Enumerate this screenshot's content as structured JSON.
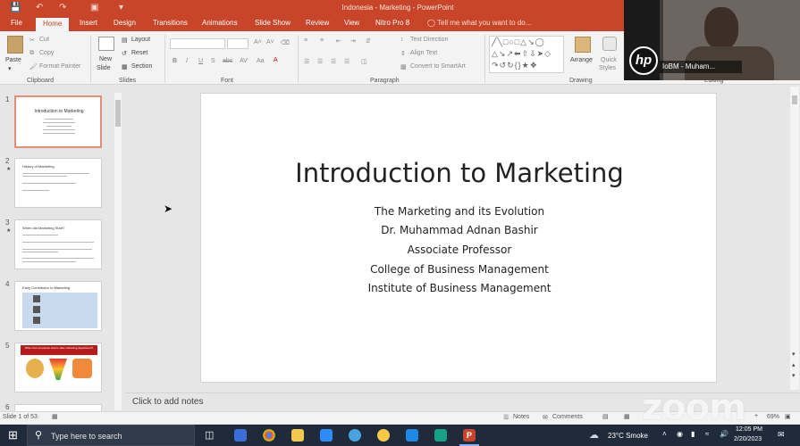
{
  "window": {
    "title": "Indonesia - Marketing - PowerPoint",
    "accent": "#c8452a"
  },
  "tabs": [
    "File",
    "Home",
    "Insert",
    "Design",
    "Transitions",
    "Animations",
    "Slide Show",
    "Review",
    "View",
    "Nitro Pro 8"
  ],
  "tell_me": "Tell me what you want to do...",
  "ribbon": {
    "clipboard": {
      "paste": "Paste",
      "cut": "Cut",
      "copy": "Copy",
      "format_painter": "Format Painter",
      "label": "Clipboard"
    },
    "slides": {
      "new_slide_1": "New",
      "new_slide_2": "Slide",
      "layout": "Layout",
      "reset": "Reset",
      "section": "Section",
      "label": "Slides"
    },
    "font": {
      "bold": "B",
      "italic": "I",
      "underline": "U",
      "shadow": "S",
      "strike": "abc",
      "spacing": "AV",
      "case": "Aa",
      "label": "Font"
    },
    "paragraph": {
      "text_direction": "Text Direction",
      "align_text": "Align Text",
      "convert": "Convert to SmartArt",
      "label": "Paragraph"
    },
    "drawing": {
      "arrange": "Arrange",
      "quick_1": "Quick",
      "quick_2": "Styles",
      "label": "Drawing"
    },
    "editing": {
      "label": "Editing"
    }
  },
  "thumbnails": [
    {
      "num": "1",
      "title": "Introduction to Marketing"
    },
    {
      "num": "2",
      "title": "History of Marketing"
    },
    {
      "num": "3",
      "title": "When did Marketing Start?"
    },
    {
      "num": "4",
      "title": "Early Contributor to Marketing"
    },
    {
      "num": "5",
      "title": "When did companies start to take marketing department?"
    },
    {
      "num": "6",
      "title": ""
    }
  ],
  "slide": {
    "title": "Introduction to Marketing",
    "lines": [
      "The Marketing and its Evolution",
      "Dr. Muhammad Adnan Bashir",
      "Associate Professor",
      "College of Business Management",
      "Institute of Business Management"
    ]
  },
  "notes_placeholder": "Click to add notes",
  "status": {
    "slide_count": "Slide 1 of 53",
    "notes": "Notes",
    "comments": "Comments",
    "zoom": "69%"
  },
  "taskbar": {
    "search_placeholder": "Type here to search",
    "weather": "23°C  Smoke",
    "time": "12:05 PM",
    "date": "2/20/2023"
  },
  "video": {
    "name": "IoBM - Muham...",
    "logo": "hp"
  },
  "zoom_watermark": "zoom"
}
